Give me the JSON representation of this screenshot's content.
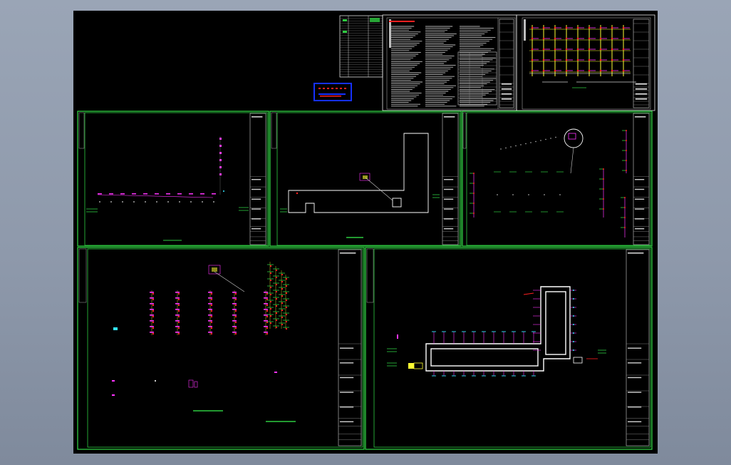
{
  "viewer": {
    "background_color": "#8e99ab",
    "canvas_color": "#000000",
    "sheet_frame_color": "#2ecc40"
  },
  "sheets": [
    {
      "id": "index-table",
      "title": "",
      "kind": "schedule"
    },
    {
      "id": "design-notes",
      "title": "",
      "kind": "notes"
    },
    {
      "id": "system-riser",
      "title": "",
      "kind": "riser-diagram"
    },
    {
      "id": "plan-1",
      "title": "",
      "kind": "floor-plan"
    },
    {
      "id": "plan-2",
      "title": "",
      "kind": "floor-plan"
    },
    {
      "id": "plan-3",
      "title": "",
      "kind": "floor-plan"
    },
    {
      "id": "plan-4",
      "title": "",
      "kind": "riser-layout"
    },
    {
      "id": "plan-5",
      "title": "",
      "kind": "floor-plan"
    }
  ],
  "legend_block": {
    "color": "#1530ff",
    "text_color": "#ff3030"
  },
  "colors": {
    "frame": "#2ecc40",
    "pipe_magenta": "#ff33ff",
    "pipe_red": "#ff2020",
    "pipe_yellow": "#ffff33",
    "pipe_cyan": "#33e6ff",
    "wall_white": "#ffffff",
    "text_grey": "#cfcfcf"
  }
}
